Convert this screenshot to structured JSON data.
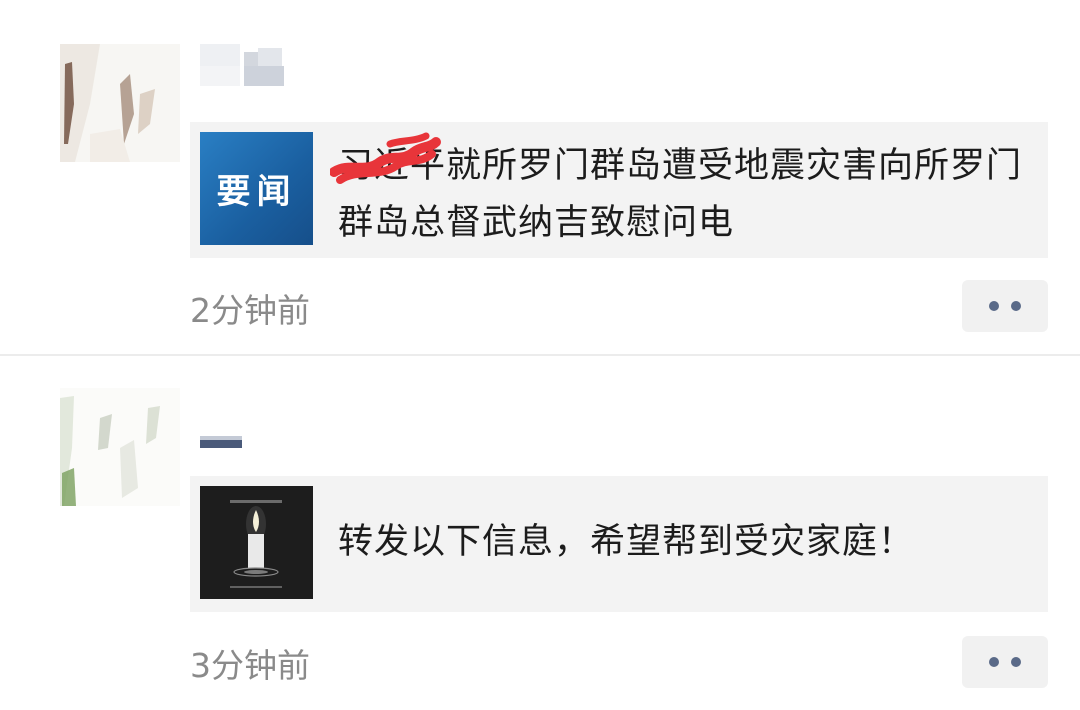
{
  "posts": [
    {
      "card": {
        "thumb_label": "要闻",
        "text": "习近平就所罗门群岛遭受地震灾害向所罗门群岛总督武纳吉致慰问电"
      },
      "timestamp": "2分钟前",
      "more_icon": "more-dots-icon"
    },
    {
      "card": {
        "thumb_icon": "candle-icon",
        "text": "转发以下信息，希望帮到受灾家庭！"
      },
      "timestamp": "3分钟前",
      "more_icon": "more-dots-icon"
    }
  ],
  "colors": {
    "news_thumb_bg": "#1f6fb4",
    "more_dots": "#5a6a88",
    "redaction": "#e8353a"
  }
}
